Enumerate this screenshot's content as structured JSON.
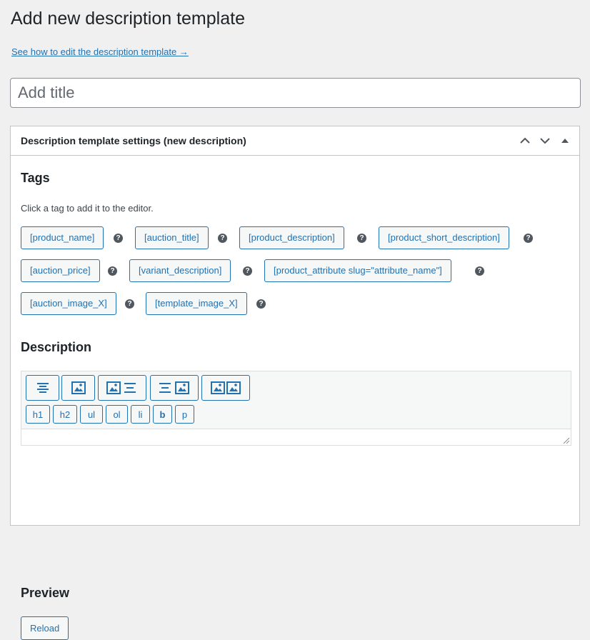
{
  "page": {
    "title": "Add new description template",
    "help_link": "See how to edit the description template →",
    "title_placeholder": "Add title"
  },
  "postbox": {
    "title": "Description template settings (new description)"
  },
  "tags": {
    "heading": "Tags",
    "hint": "Click a tag to add it to the editor.",
    "help_glyph": "?",
    "items": [
      "[product_name]",
      "[auction_title]",
      "[product_description]",
      "[product_short_description]",
      "[auction_price]",
      "[variant_description]",
      "[product_attribute slug=\"attribute_name\"]",
      "[auction_image_X]",
      "[template_image_X]"
    ]
  },
  "description": {
    "heading": "Description",
    "format_buttons": [
      "h1",
      "h2",
      "ul",
      "ol",
      "li",
      "b",
      "p"
    ],
    "layout_buttons": [
      "align-center-icon",
      "image-icon",
      "image-text-icon",
      "text-image-icon",
      "two-images-icon"
    ]
  },
  "preview": {
    "heading": "Preview",
    "reload_label": "Reload"
  },
  "colors": {
    "accent": "#2271b1",
    "background": "#f0f0f1",
    "border": "#c3c4c7"
  }
}
